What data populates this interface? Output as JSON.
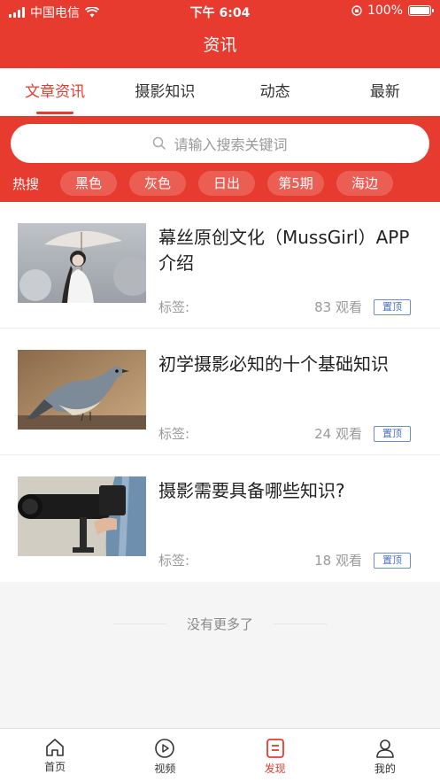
{
  "status_bar": {
    "carrier": "中国电信",
    "time": "下午 6:04",
    "battery": "100%",
    "battery_level": 1.0
  },
  "header": {
    "title": "资讯"
  },
  "tabs": [
    {
      "label": "文章资讯",
      "active": true
    },
    {
      "label": "摄影知识",
      "active": false
    },
    {
      "label": "动态",
      "active": false
    },
    {
      "label": "最新",
      "active": false
    }
  ],
  "search": {
    "placeholder": "请输入搜索关键词"
  },
  "hot_search": {
    "label": "热搜",
    "keywords": [
      "黑色",
      "灰色",
      "日出",
      "第5期",
      "海边"
    ]
  },
  "articles": [
    {
      "title": "幕丝原创文化（MussGirl）APP介绍",
      "tag_label": "标签:",
      "views": "83 观看",
      "badge": "置顶",
      "image": "woman-with-umbrella"
    },
    {
      "title": "初学摄影必知的十个基础知识",
      "tag_label": "标签:",
      "views": "24 观看",
      "badge": "置顶",
      "image": "bird-on-branch"
    },
    {
      "title": "摄影需要具备哪些知识?",
      "tag_label": "标签:",
      "views": "18 观看",
      "badge": "置顶",
      "image": "camera-telephoto-lens"
    }
  ],
  "footer_text": "没有更多了",
  "tabbar": [
    {
      "label": "首页",
      "icon": "home-icon",
      "active": false
    },
    {
      "label": "视频",
      "icon": "play-icon",
      "active": false
    },
    {
      "label": "发现",
      "icon": "discover-icon",
      "active": true
    },
    {
      "label": "我的",
      "icon": "user-icon",
      "active": false
    }
  ],
  "colors": {
    "brand": "#e73b2f",
    "badge": "#4c6fc8"
  }
}
